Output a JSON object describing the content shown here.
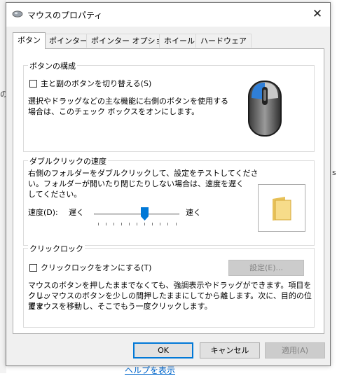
{
  "background": {
    "fragment_left": "の",
    "fragment_right": "s",
    "link": "ヘルプを表示"
  },
  "window": {
    "title": "マウスのプロパティ",
    "close_glyph": "✕"
  },
  "tabs": [
    {
      "label": "ボタン",
      "active": true
    },
    {
      "label": "ポインター",
      "active": false
    },
    {
      "label": "ポインター オプション",
      "active": false
    },
    {
      "label": "ホイール",
      "active": false
    },
    {
      "label": "ハードウェア",
      "active": false
    }
  ],
  "button_config": {
    "legend": "ボタンの構成",
    "checkbox_label": "主と副のボタンを切り替える(S)",
    "checked": false,
    "description_line1": "選択やドラッグなどの主な機能に右側のボタンを使用する",
    "description_line2": "場合は、このチェック ボックスをオンにします。",
    "icon": "mouse-icon"
  },
  "double_click": {
    "legend": "ダブルクリックの速度",
    "description_line1": "右側のフォルダーをダブルクリックして、設定をテストしてくださ",
    "description_line2": "い。フォルダーが開いたり閉じたりしない場合は、速度を遅く",
    "description_line3": "してください。",
    "speed_label": "速度(D):",
    "slow_label": "遅く",
    "fast_label": "速く",
    "slider_value_fraction": 0.6,
    "tick_count": 11,
    "test_icon": "folder-icon"
  },
  "click_lock": {
    "legend": "クリックロック",
    "checkbox_label": "クリックロックをオンにする(T)",
    "checked": false,
    "settings_button": "設定(E)...",
    "description_line1": "マウスのボタンを押したままでなくても、強調表示やドラッグができます。項目をクリッ",
    "description_line2": "クし、マウスのボタンを少しの間押したままにしてから離します。次に、目的の位置ま",
    "description_line3": "でマウスを移動し、そこでもう一度クリックします。"
  },
  "footer": {
    "ok": "OK",
    "cancel": "キャンセル",
    "apply": "適用(A)"
  },
  "colors": {
    "accent": "#0078d7",
    "mouse_button": "#2f7fd8"
  }
}
